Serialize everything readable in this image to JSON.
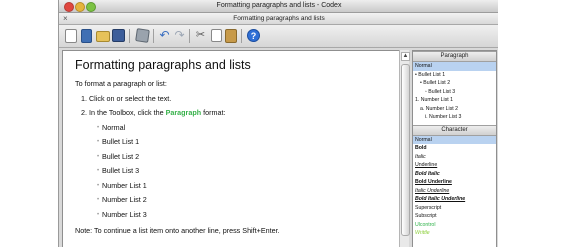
{
  "window": {
    "title": "Formatting paragraphs and lists - Codex",
    "subtitle": "Formatting paragraphs and lists",
    "close_glyph": "×"
  },
  "toolbar": {
    "icons": [
      "new-page-icon",
      "book-icon",
      "open-folder-icon",
      "save-disk-icon",
      "cube-icon",
      "undo-icon",
      "redo-icon",
      "cut-icon",
      "copy-icon",
      "paste-icon",
      "help-icon"
    ],
    "undo_glyph": "↶",
    "redo_glyph": "↷",
    "cut_glyph": "✂",
    "help_glyph": "?"
  },
  "document": {
    "title": "Formatting paragraphs and lists",
    "intro": "To format a paragraph or list:",
    "step1": "1.  Click on or select the text.",
    "step2_before": "2.  In the Toolbox, click the ",
    "step2_link": "Paragraph",
    "step2_after": " format:",
    "items": [
      "Normal",
      "Bullet List 1",
      "Bullet List 2",
      "Bullet List 3",
      "Number List 1",
      "Number List 2",
      "Number List 3"
    ],
    "note": "Note: To continue a list item onto another line, press Shift+Enter."
  },
  "toolbox": {
    "paragraph_header": "Paragraph",
    "paragraph_items": {
      "normal": "Normal",
      "bullet1": "• Bullet List 1",
      "bullet2": "• Bullet List 2",
      "bullet3": "◦ Bullet List 3",
      "number1": "1.  Number List 1",
      "number2": "a.  Number List 2",
      "number3": "i.  Number List 3"
    },
    "character_header": "Character",
    "character_items": {
      "normal": "Normal",
      "bold": "Bold",
      "italic": "Italic",
      "underline": "Underline",
      "bold_italic": "Bold Italic",
      "bold_underline": "Bold Underline",
      "italic_underline": "Italic Underline",
      "bold_italic_underline": "Bold Italic Underline",
      "superscript": "Superscript",
      "subscript": "Subscript",
      "ulcontrol": "Ulcontrol",
      "writtle": "Writtle"
    }
  },
  "colors": {
    "selection": "#b9d2f0",
    "link_green": "#37b14a"
  }
}
